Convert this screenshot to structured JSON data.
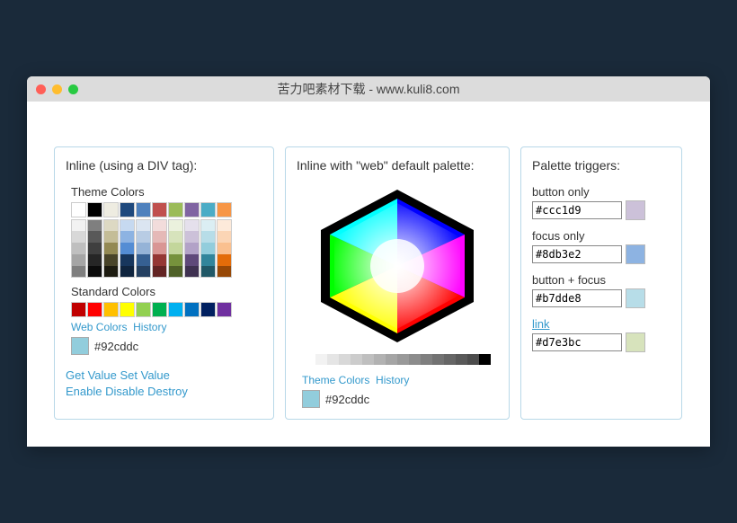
{
  "window": {
    "title": "苦力吧素材下载 - www.kuli8.com"
  },
  "panel1": {
    "title": "Inline (using a DIV tag):",
    "theme_label": "Theme Colors",
    "standard_label": "Standard Colors",
    "theme_colors": [
      "#ffffff",
      "#000000",
      "#eeece1",
      "#1f497d",
      "#4f81bd",
      "#c0504d",
      "#9bbb59",
      "#8064a2",
      "#4bacc6",
      "#f79646"
    ],
    "theme_shades": [
      [
        "#f2f2f2",
        "#d8d8d8",
        "#bfbfbf",
        "#a5a5a5",
        "#7f7f7f"
      ],
      [
        "#7f7f7f",
        "#595959",
        "#3f3f3f",
        "#262626",
        "#0c0c0c"
      ],
      [
        "#ddd9c3",
        "#c4bd97",
        "#938953",
        "#494429",
        "#1d1b10"
      ],
      [
        "#c6d9f0",
        "#8db3e2",
        "#548dd4",
        "#17365d",
        "#0f243e"
      ],
      [
        "#dbe5f1",
        "#b8cce4",
        "#95b3d7",
        "#366092",
        "#244061"
      ],
      [
        "#f2dcdb",
        "#e5b9b7",
        "#d99694",
        "#953734",
        "#632423"
      ],
      [
        "#ebf1dd",
        "#d7e3bc",
        "#c3d69b",
        "#76923c",
        "#4f6128"
      ],
      [
        "#e5e0ec",
        "#ccc1d9",
        "#b2a2c7",
        "#5f497a",
        "#3f3151"
      ],
      [
        "#dbeef3",
        "#b7dde8",
        "#92cddc",
        "#31859b",
        "#205867"
      ],
      [
        "#fdeada",
        "#fbd5b5",
        "#fac08f",
        "#e36c09",
        "#974806"
      ]
    ],
    "standard_colors": [
      "#c00000",
      "#ff0000",
      "#ffc000",
      "#ffff00",
      "#92d050",
      "#00b050",
      "#00b0f0",
      "#0070c0",
      "#002060",
      "#7030a0"
    ],
    "webcolors_link": "Web Colors",
    "history_link": "History",
    "selected_color": "#92cddc",
    "selected_text": "#92cddc",
    "actions": {
      "get": "Get Value",
      "set": "Set Value",
      "enable": "Enable",
      "disable": "Disable",
      "destroy": "Destroy"
    }
  },
  "panel2": {
    "title": "Inline with \"web\" default palette:",
    "themecolors_link": "Theme Colors",
    "history_link": "History",
    "selected_color": "#92cddc",
    "selected_text": "#92cddc",
    "gray_strip": [
      "#ffffff",
      "#f2f2f2",
      "#e5e5e5",
      "#d8d8d8",
      "#cccccc",
      "#bfbfbf",
      "#b2b2b2",
      "#a5a5a5",
      "#999999",
      "#8c8c8c",
      "#7f7f7f",
      "#727272",
      "#666666",
      "#595959",
      "#4c4c4c",
      "#000000"
    ]
  },
  "panel3": {
    "title": "Palette triggers:",
    "triggers": [
      {
        "label": "button only",
        "value": "#ccc1d9",
        "swatch": "#ccc1d9",
        "is_link": false
      },
      {
        "label": "focus only",
        "value": "#8db3e2",
        "swatch": "#8db3e2",
        "is_link": false
      },
      {
        "label": "button + focus",
        "value": "#b7dde8",
        "swatch": "#b7dde8",
        "is_link": false
      },
      {
        "label": "link",
        "value": "#d7e3bc",
        "swatch": "#d7e3bc",
        "is_link": true
      }
    ]
  }
}
